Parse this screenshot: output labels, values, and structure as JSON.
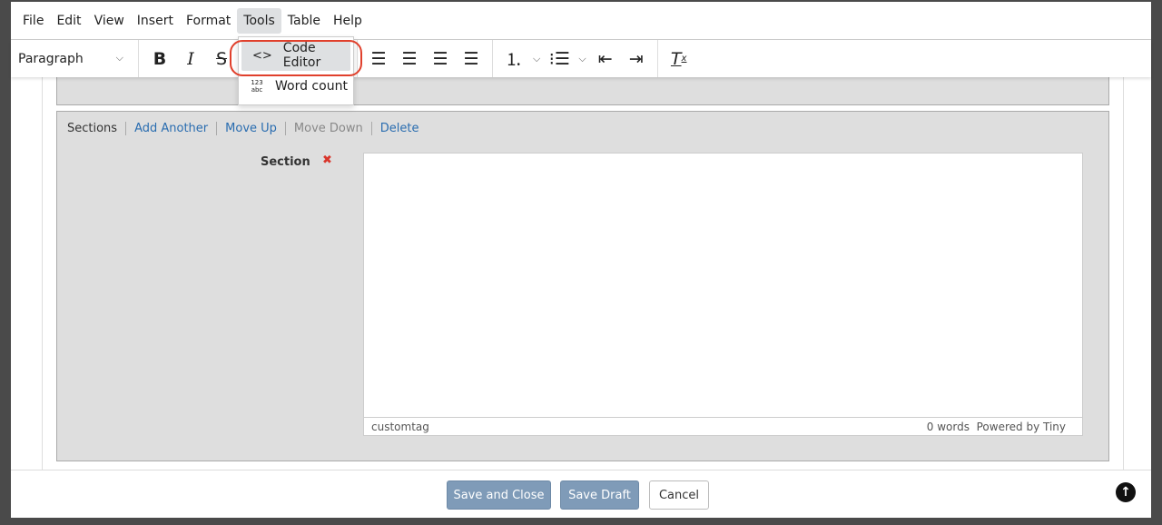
{
  "menubar": [
    "File",
    "Edit",
    "View",
    "Insert",
    "Format",
    "Tools",
    "Table",
    "Help"
  ],
  "active_menu": "Tools",
  "toolbar": {
    "block_format": "Paragraph"
  },
  "tools_menu": [
    {
      "icon": "code-icon",
      "glyph": "<>",
      "label": "Code Editor"
    },
    {
      "icon": "word-count-icon",
      "glyph": "123/abc",
      "label": "Word count"
    }
  ],
  "highlight_color": "#e0402c",
  "sections": {
    "label": "Sections",
    "actions": [
      "Add Another",
      "Move Up",
      "Move Down",
      "Delete"
    ],
    "disabled": [
      "Move Down"
    ]
  },
  "field": {
    "label": "Section",
    "required_mark": "✖"
  },
  "editor_status": {
    "path": "customtag",
    "words": "0 words",
    "branding": "Powered by Tiny"
  },
  "footer": {
    "save_close": "Save and Close",
    "save_draft": "Save Draft",
    "cancel": "Cancel"
  }
}
